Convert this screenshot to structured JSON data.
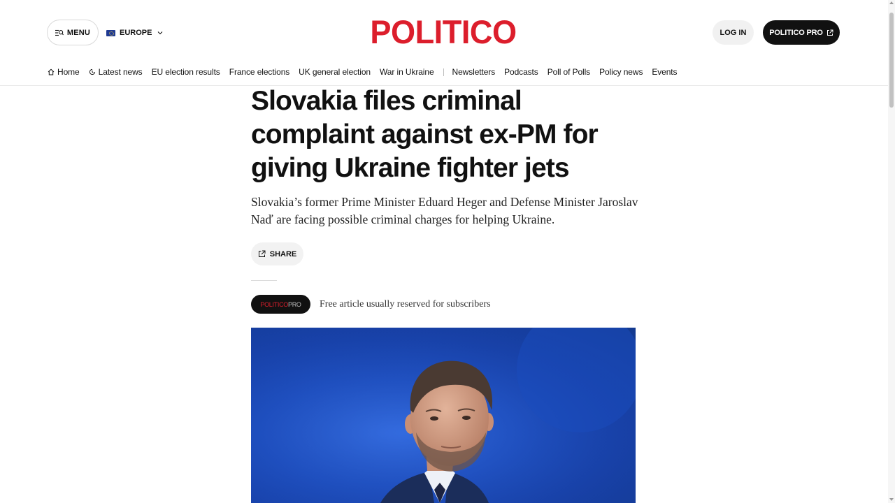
{
  "header": {
    "menu_label": "MENU",
    "edition_label": "EUROPE",
    "logo_text": "POLITICO",
    "login_label": "LOG IN",
    "pro_label": "POLITICO PRO"
  },
  "nav": {
    "items": [
      {
        "label": "Home"
      },
      {
        "label": "Latest news"
      },
      {
        "label": "EU election results"
      },
      {
        "label": "France elections"
      },
      {
        "label": "UK general election"
      },
      {
        "label": "War in Ukraine"
      },
      {
        "label": "Newsletters"
      },
      {
        "label": "Podcasts"
      },
      {
        "label": "Poll of Polls"
      },
      {
        "label": "Policy news"
      },
      {
        "label": "Events"
      }
    ]
  },
  "article": {
    "headline": "Slovakia files criminal complaint against ex-PM for giving Ukraine fighter jets",
    "dek": "Slovakia’s former Prime Minister Eduard Heger and Defense Minister Jaroslav Naď are facing possible criminal charges for helping Ukraine.",
    "share_label": "SHARE",
    "badge_part1": "POLITICO",
    "badge_part2": "PRO",
    "free_note": "Free article usually reserved for subscribers"
  },
  "colors": {
    "brand_red": "#dc1e2c",
    "dark": "#111111",
    "photo_blue": "#1d4fc4"
  },
  "icons": {
    "menu": "search-menu-icon",
    "edition": "eu-flag-icon",
    "edition_chevron": "chevron-down-icon",
    "pro_external": "external-link-icon",
    "home": "home-icon",
    "latest": "clock-icon",
    "share": "share-icon"
  }
}
